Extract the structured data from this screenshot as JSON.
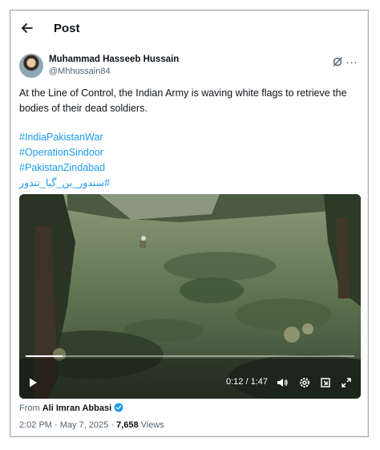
{
  "header": {
    "title": "Post"
  },
  "author": {
    "name": "Muhammad Hasseeb Hussain",
    "handle": "@Mhhussain84"
  },
  "post": {
    "text": "At the Line of Control, the Indian Army is waving white flags to retrieve the bodies of their dead soldiers.",
    "hashtags": [
      "#IndiaPakistanWar",
      "#OperationSindoor",
      "#PakistanZindabad",
      "#سندور_بن_گیا_تندور"
    ]
  },
  "video": {
    "time_current": "0:12",
    "time_separator": " / ",
    "time_total": "1:47",
    "progress": 0.112
  },
  "attribution": {
    "label": "From",
    "source": "Ali Imran Abbasi"
  },
  "meta": {
    "time": "2:02 PM",
    "separator": " · ",
    "date": "May 7, 2025",
    "views_count": "7,658",
    "views_label": " Views"
  },
  "colors": {
    "link": "#1d9bf0",
    "text": "#0f1419",
    "secondary": "#536471"
  }
}
